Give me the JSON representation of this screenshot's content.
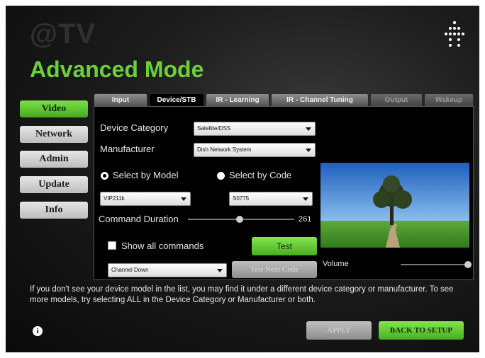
{
  "app": {
    "logo": "@TV",
    "title": "Advanced Mode"
  },
  "sidebar": {
    "items": [
      {
        "label": "Video",
        "active": true
      },
      {
        "label": "Network",
        "active": false
      },
      {
        "label": "Admin",
        "active": false
      },
      {
        "label": "Update",
        "active": false
      },
      {
        "label": "Info",
        "active": false
      }
    ]
  },
  "tabs": [
    {
      "label": "Input",
      "state": "normal"
    },
    {
      "label": "Device/STB",
      "state": "active"
    },
    {
      "label": "IR - Learning",
      "state": "normal"
    },
    {
      "label": "IR - Channel Tuning",
      "state": "normal"
    },
    {
      "label": "Output",
      "state": "disabled"
    },
    {
      "label": "Wakeup",
      "state": "disabled"
    }
  ],
  "form": {
    "device_category_label": "Device Category",
    "device_category_value": "Satellite/DSS",
    "manufacturer_label": "Manufacturer",
    "manufacturer_value": "Dish Network System",
    "select_by_model_label": "Select by Model",
    "select_by_code_label": "Select by Code",
    "model_value": "VIP211k",
    "code_value": "S0775",
    "command_duration_label": "Command Duration",
    "command_duration_value": "261",
    "show_all_commands_label": "Show all commands",
    "test_label": "Test",
    "command_value": "Channel Down",
    "test_next_code_label": "Test Next Code",
    "volume_label": "Volume"
  },
  "help_text": "If you don't see your device model in the list, you may find it under a different device category or manufacturer. To see more models, try selecting ALL in the Device Category or Manufacturer or both.",
  "footer": {
    "apply_label": "APPLY",
    "back_label": "BACK TO SETUP"
  },
  "colors": {
    "accent": "#5cc22e",
    "panel": "#000000",
    "background": "#1c1c1c"
  },
  "icons": {
    "info": "info-icon",
    "brand": "dot-grid-icon"
  }
}
